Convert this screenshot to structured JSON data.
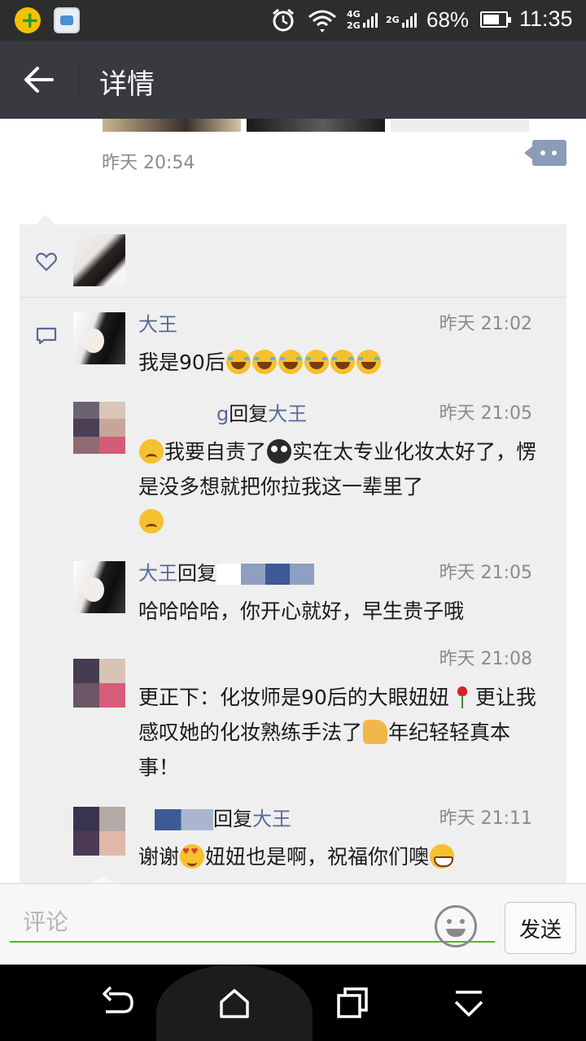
{
  "status_bar": {
    "network_4g": "4G",
    "network_2g": "2G",
    "network_2g_b": "2G",
    "battery": "68%",
    "time": "11:35"
  },
  "header": {
    "title": "详情"
  },
  "post": {
    "time": "昨天 20:54"
  },
  "comments": [
    {
      "author": "大王",
      "time": "昨天 21:02",
      "text": "我是90后"
    },
    {
      "author": "g",
      "reply_word": "回复",
      "reply_to": "大王",
      "time": "昨天 21:05",
      "text_a": "我要自责了",
      "text_b": "实在太专业化妆太好了，愣是没多想就把你拉我这一辈里了"
    },
    {
      "author": "大王",
      "reply_word": "回复",
      "time": "昨天 21:05",
      "text": "哈哈哈哈，你开心就好，早生贵子哦"
    },
    {
      "time": "昨天 21:08",
      "text_a": "更正下：化妆师是90后的大眼妞妞",
      "text_b": "更让我感叹她的化妆熟练手法了",
      "text_c": "年纪轻轻真本事！"
    },
    {
      "reply_word": "回复",
      "reply_to": "大王",
      "time": "昨天 21:11",
      "text_a": "谢谢",
      "text_b": "妞妞也是啊，祝福你们噢"
    }
  ],
  "input": {
    "placeholder": "评论",
    "send_label": "发送"
  },
  "colors": {
    "title_bar": "#393a3f",
    "name_link": "#576b95",
    "input_underline": "#45c01a",
    "panel": "#efeff0"
  },
  "icons": [
    "back-arrow-icon",
    "heart-icon",
    "comment-bubble-icon",
    "emoji-icon",
    "nav-back-icon",
    "nav-home-icon",
    "nav-recents-icon",
    "nav-menu-icon"
  ]
}
